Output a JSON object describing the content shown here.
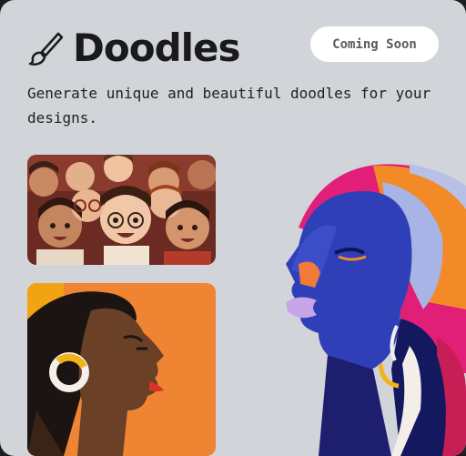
{
  "card": {
    "title": "Doodles",
    "badge": "Coming Soon",
    "description": "Generate unique and beautiful doodles for your designs."
  },
  "icons": {
    "title_icon": "paintbrush-icon"
  },
  "colors": {
    "card_bg": "#d1d4d9",
    "badge_bg": "#ffffff",
    "title": "#1a1a1a"
  }
}
